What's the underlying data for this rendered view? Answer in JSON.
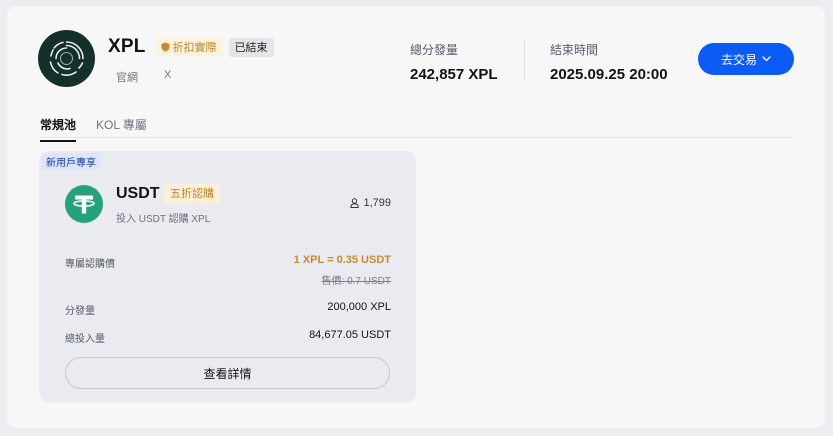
{
  "header": {
    "token_name": "XPL",
    "discount_badge": "折扣實際",
    "status_badge": "已結束",
    "links": [
      "官網",
      "X"
    ],
    "stats": [
      {
        "label": "總分發量",
        "value": "242,857 XPL"
      },
      {
        "label": "結束時間",
        "value": "2025.09.25 20:00"
      }
    ],
    "trade_button": "去交易"
  },
  "tabs": [
    {
      "label": "常規池",
      "active": true
    },
    {
      "label": "KOL 專屬",
      "active": false
    }
  ],
  "pool_card": {
    "tag": "新用戶專享",
    "asset": "USDT",
    "asset_badge": "五折認購",
    "description": "投入 USDT 認購 XPL",
    "participants": "1,799",
    "rows": {
      "price_label": "專屬認購價",
      "price_value": "1 XPL = 0.35 USDT",
      "original_price": "售價: 0.7 USDT",
      "distribution_label": "分發量",
      "distribution_value": "200,000 XPL",
      "total_invested_label": "總投入量",
      "total_invested_value": "84,677.05 USDT"
    },
    "detail_button": "查看詳情"
  },
  "colors": {
    "primary": "#0a5cf5",
    "accent_gold": "#c58a33",
    "usdt_green": "#26a17b",
    "logo_bg": "#15302b"
  },
  "icons": {
    "logo": "xpl-logo",
    "shield": "shield-icon",
    "chevron": "chevron-down-icon",
    "usdt": "tether-icon",
    "user": "user-icon"
  }
}
